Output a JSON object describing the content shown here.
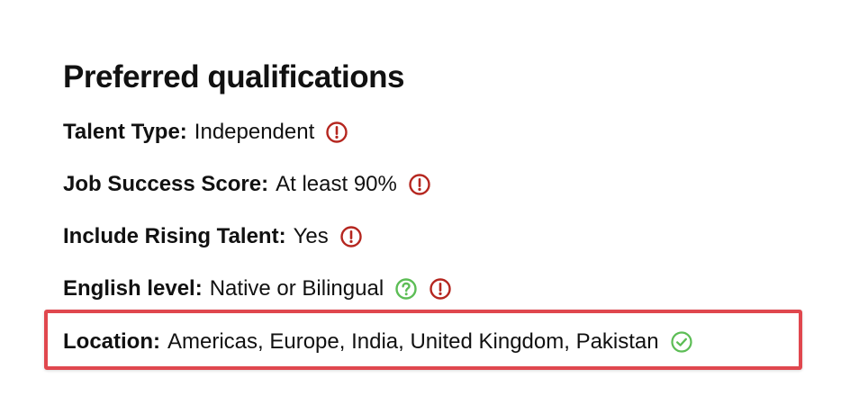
{
  "section": {
    "title": "Preferred qualifications",
    "items": [
      {
        "label": "Talent Type:",
        "value": "Independent",
        "icons": [
          "alert-icon"
        ]
      },
      {
        "label": "Job Success Score:",
        "value": "At least 90%",
        "icons": [
          "alert-icon"
        ]
      },
      {
        "label": "Include Rising Talent:",
        "value": "Yes",
        "icons": [
          "alert-icon"
        ]
      },
      {
        "label": "English level:",
        "value": "Native or Bilingual",
        "icons": [
          "help-icon",
          "alert-icon"
        ]
      },
      {
        "label": "Location:",
        "value": "Americas, Europe, India, United Kingdom, Pakistan",
        "icons": [
          "check-icon"
        ],
        "highlighted": true
      }
    ]
  },
  "colors": {
    "alert": "#b5261f",
    "success": "#5cbd55",
    "highlight_border": "#e0474e",
    "text": "#111111"
  }
}
